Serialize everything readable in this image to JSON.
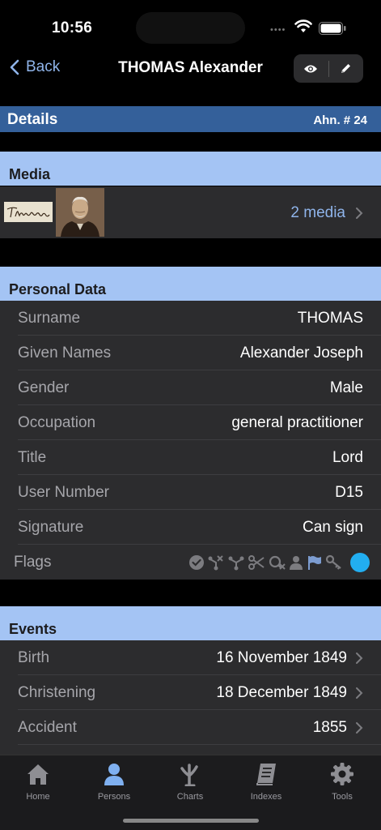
{
  "status": {
    "time": "10:56"
  },
  "nav": {
    "back_label": "Back",
    "title": "THOMAS Alexander"
  },
  "details": {
    "title": "Details",
    "ahn": "Ahn. #  24"
  },
  "media": {
    "header": "Media",
    "count": "2 media"
  },
  "personal": {
    "header": "Personal Data",
    "rows": [
      {
        "label": "Surname",
        "value": "THOMAS"
      },
      {
        "label": "Given Names",
        "value": "Alexander Joseph"
      },
      {
        "label": "Gender",
        "value": "Male"
      },
      {
        "label": "Occupation",
        "value": "general practitioner"
      },
      {
        "label": "Title",
        "value": "Lord"
      },
      {
        "label": "User Number",
        "value": "D15"
      },
      {
        "label": "Signature",
        "value": "Can sign"
      }
    ],
    "flags_label": "Flags",
    "flag_icons": [
      "check-circle-icon",
      "branch-cross-icon",
      "branch-icon",
      "scissors-icon",
      "search-cross-icon",
      "person-icon",
      "flag-icon",
      "key-icon",
      "blue-circle-flag"
    ],
    "flag_color": "#22aef0"
  },
  "events": {
    "header": "Events",
    "rows": [
      {
        "label": "Birth",
        "value": "16 November 1849"
      },
      {
        "label": "Christening",
        "value": "18 December 1849"
      },
      {
        "label": "Accident",
        "value": "1855"
      }
    ]
  },
  "tabs": [
    {
      "label": "Home",
      "icon": "house-icon",
      "active": false
    },
    {
      "label": "Persons",
      "icon": "person-icon",
      "active": true
    },
    {
      "label": "Charts",
      "icon": "tree-icon",
      "active": false
    },
    {
      "label": "Indexes",
      "icon": "book-icon",
      "active": false
    },
    {
      "label": "Tools",
      "icon": "gear-icon",
      "active": false
    }
  ],
  "colors": {
    "accent": "#8fb4ea",
    "section_header": "#a4c4f4",
    "details_header": "#34609a",
    "row_bg": "#2c2c2e"
  }
}
